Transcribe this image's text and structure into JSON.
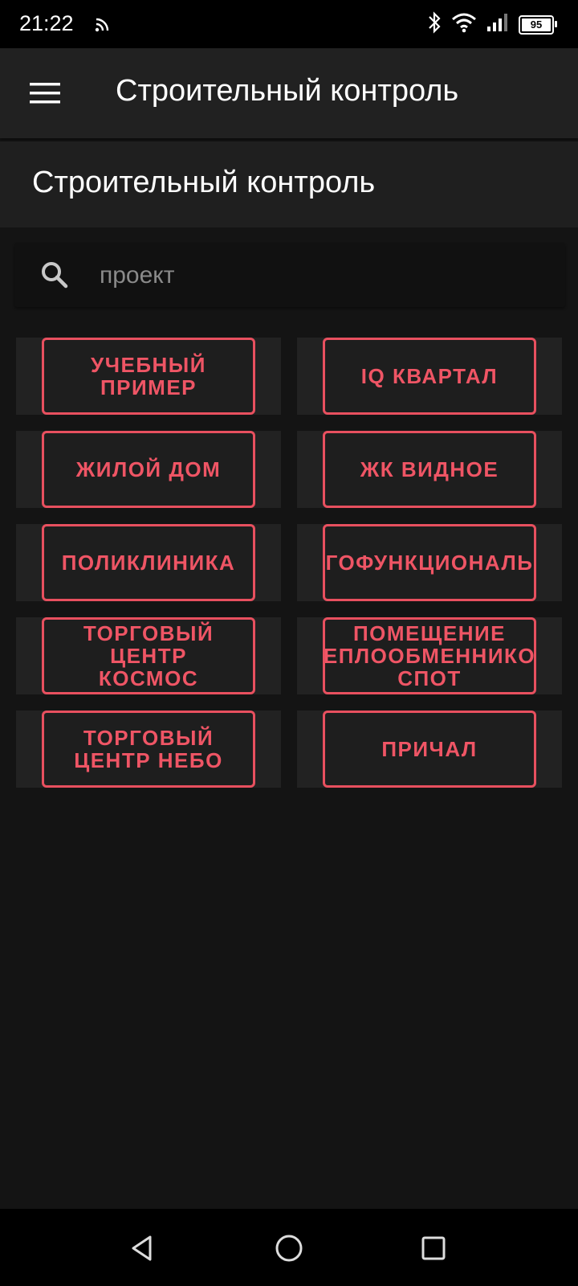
{
  "status": {
    "time": "21:22",
    "battery": "95",
    "icons": [
      "cast-icon",
      "bluetooth-icon",
      "wifi-icon",
      "signal-icon",
      "battery-icon"
    ]
  },
  "app_bar": {
    "title": "Строительный контроль",
    "menu_icon": "menu-icon"
  },
  "page": {
    "title": "Строительный контроль"
  },
  "search": {
    "placeholder": "проект",
    "icon": "search-icon"
  },
  "projects": [
    {
      "label": "УЧЕБНЫЙ\nПРИМЕР"
    },
    {
      "label": "IQ КВАРТАЛ"
    },
    {
      "label": "ЖИЛОЙ ДОМ"
    },
    {
      "label": "ЖК ВИДНОЕ"
    },
    {
      "label": "ПОЛИКЛИНИКА"
    },
    {
      "label": "ГОФУНКЦИОНАЛЬ"
    },
    {
      "label": "ТОРГОВЫЙ\nЦЕНТР\nКОСМОС"
    },
    {
      "label": "ПОМЕЩЕНИЕ\nЕПЛООБМЕННИКО\nСПОТ"
    },
    {
      "label": "ТОРГОВЫЙ\nЦЕНТР НЕБО"
    },
    {
      "label": "ПРИЧАЛ"
    }
  ],
  "colors": {
    "accent": "#e8505f",
    "background": "#141414",
    "bar": "#212121"
  },
  "nav": [
    "back-icon",
    "home-icon",
    "recents-icon"
  ]
}
